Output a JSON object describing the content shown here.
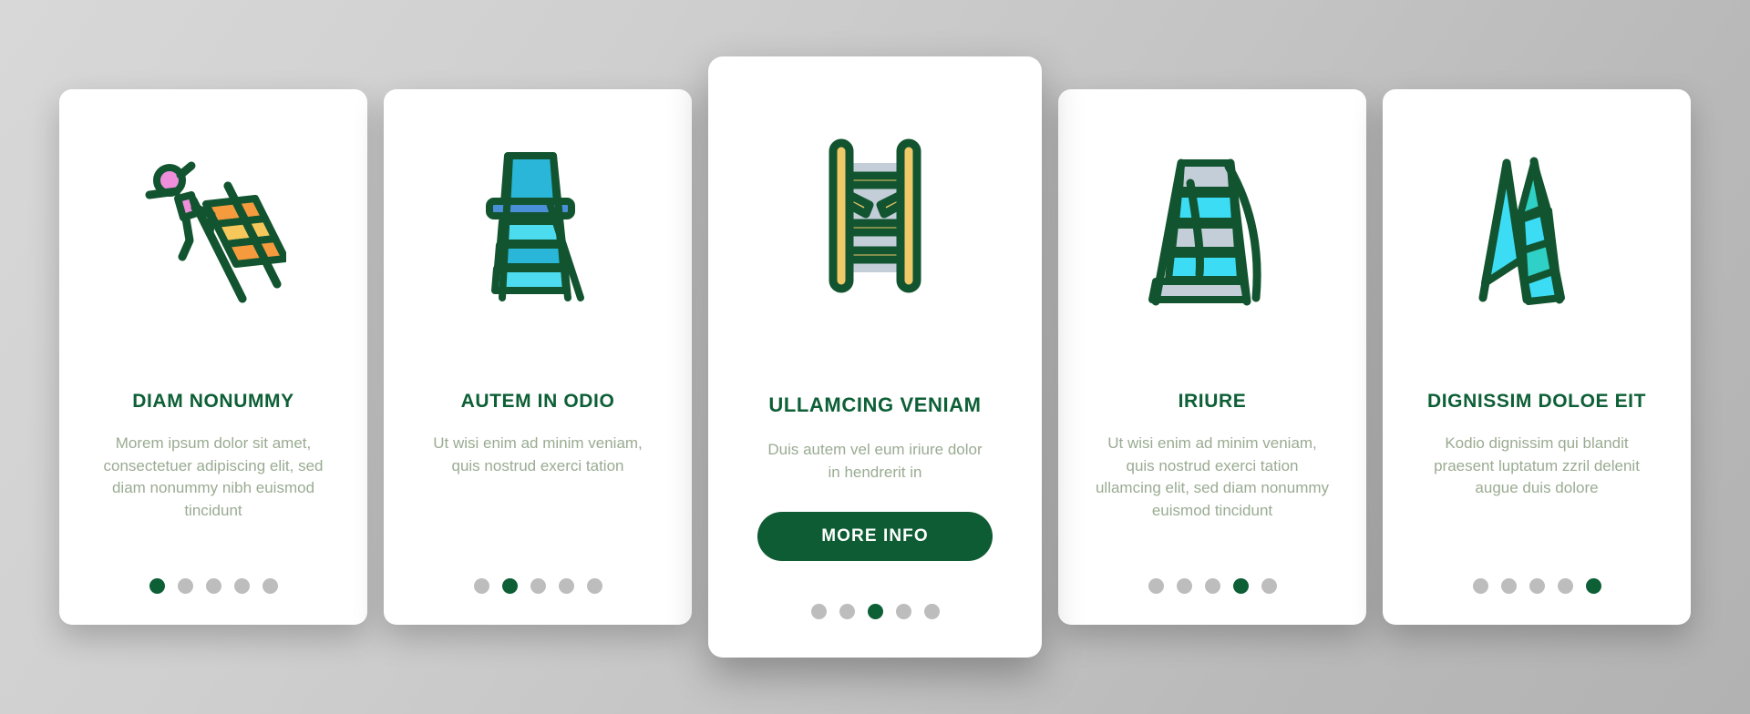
{
  "theme": {
    "accent_green": "#0d5f36",
    "body_text": "#9aab92",
    "dot_inactive": "#bdbdbd",
    "card_background": "#ffffff",
    "page_background": "#c9c9c9"
  },
  "cards": [
    {
      "icon": "person-falling-from-ladder-icon",
      "title": "DIAM NONUMMY",
      "body": "Morem ipsum dolor sit amet, consectetuer adipiscing elit, sed diam nonummy nibh euismod tincidunt",
      "dots": {
        "count": 5,
        "active_index": 0
      },
      "featured": false
    },
    {
      "icon": "step-ladder-platform-icon",
      "title": "AUTEM IN ODIO",
      "body": "Ut wisi enim ad minim veniam, quis nostrud exerci tation",
      "dots": {
        "count": 5,
        "active_index": 1
      },
      "featured": false
    },
    {
      "icon": "broken-rung-ladder-icon",
      "title": "ULLAMCING VENIAM",
      "body": "Duis autem vel eum iriure dolor in hendrerit in",
      "button_label": "MORE INFO",
      "dots": {
        "count": 5,
        "active_index": 2
      },
      "featured": true
    },
    {
      "icon": "folding-step-ladder-icon",
      "title": "IRIURE",
      "body": "Ut wisi enim ad minim veniam, quis nostrud exerci tation ullamcing elit, sed diam nonummy euismod tincidunt",
      "dots": {
        "count": 5,
        "active_index": 3
      },
      "featured": false
    },
    {
      "icon": "a-frame-ladder-icon",
      "title": "DIGNISSIM DOLOE EIT",
      "body": "Kodio dignissim qui blandit praesent luptatum zzril delenit augue duis dolore",
      "dots": {
        "count": 5,
        "active_index": 4
      },
      "featured": false
    }
  ]
}
